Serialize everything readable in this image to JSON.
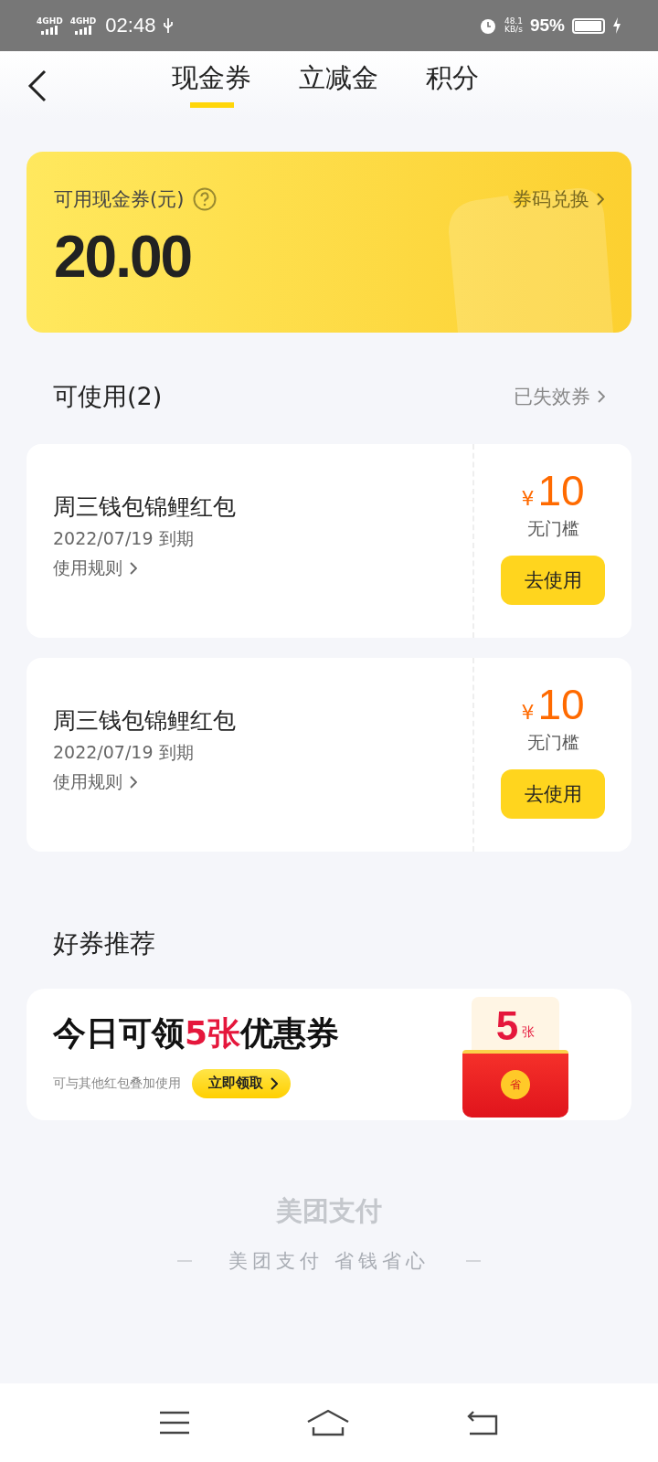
{
  "status_bar": {
    "signals": [
      "4GHD",
      "4GHD"
    ],
    "time": "02:48",
    "speed": "48.1",
    "speed_unit": "KB/s",
    "battery": "95%"
  },
  "tabs": [
    {
      "label": "现金券",
      "selected": true
    },
    {
      "label": "立减金",
      "selected": false
    },
    {
      "label": "积分",
      "selected": false
    }
  ],
  "balance_card": {
    "label": "可用现金券(元)",
    "link": "券码兑换",
    "amount": "20.00"
  },
  "available": {
    "title": "可使用(2)",
    "link": "已失效券"
  },
  "coupons": [
    {
      "name": "周三钱包锦鲤红包",
      "expiry": "2022/07/19 到期",
      "rules": "使用规则",
      "currency": "¥",
      "value": "10",
      "condition": "无门槛",
      "button": "去使用"
    },
    {
      "name": "周三钱包锦鲤红包",
      "expiry": "2022/07/19 到期",
      "rules": "使用规则",
      "currency": "¥",
      "value": "10",
      "condition": "无门槛",
      "button": "去使用"
    }
  ],
  "recommend": {
    "title": "好券推荐",
    "headline_before": "今日可领",
    "headline_highlight": "5张",
    "headline_after": "优惠券",
    "note": "可与其他红包叠加使用",
    "button": "立即领取",
    "envelope_count": "5",
    "envelope_unit": "张",
    "envelope_seal": "省"
  },
  "footer": {
    "brand": "美团支付",
    "slogan": "美团支付 省钱省心"
  }
}
